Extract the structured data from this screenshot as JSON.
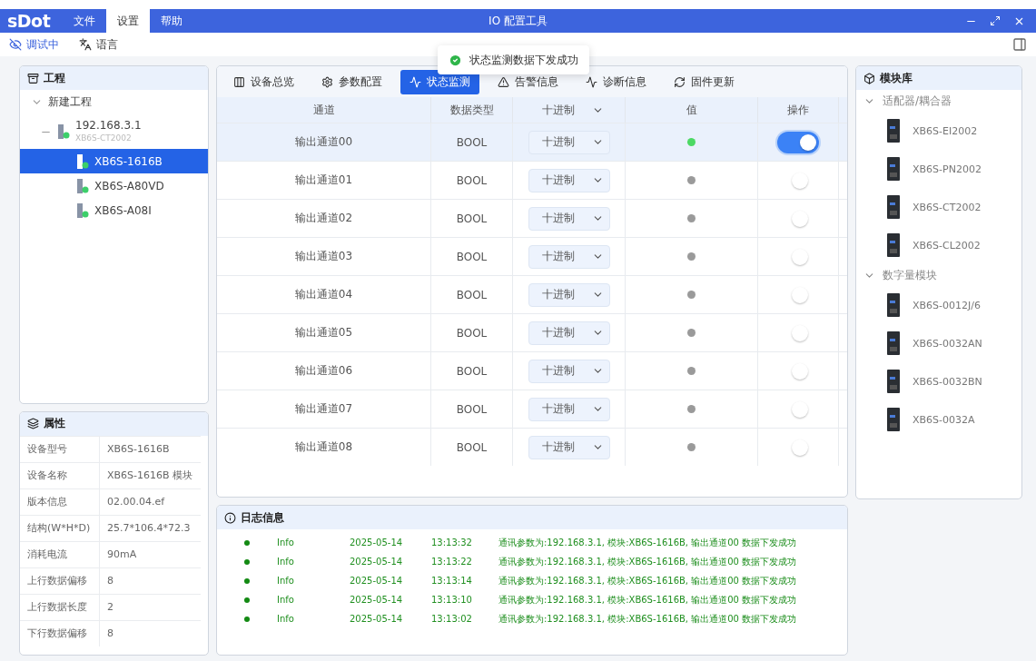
{
  "titlebar": {
    "logo": "sDot",
    "menus": [
      {
        "label": "文件",
        "selected": false
      },
      {
        "label": "设置",
        "selected": true
      },
      {
        "label": "帮助",
        "selected": false
      }
    ],
    "title": "IO 配置工具"
  },
  "toolbar": [
    {
      "kind": "debug",
      "label": "调试中"
    },
    {
      "kind": "language",
      "label": "语言"
    }
  ],
  "toast": {
    "message": "状态监测数据下发成功"
  },
  "project": {
    "title": "工程",
    "tree": [
      {
        "label": "新建工程",
        "expanded": true,
        "selected": false,
        "children": [
          {
            "label": "192.168.3.1",
            "sublabel": "XB6S-CT2002",
            "selected": false,
            "children": [
              {
                "label": "XB6S-1616B",
                "selected": true
              },
              {
                "label": "XB6S-A80VD",
                "selected": false
              },
              {
                "label": "XB6S-A08I",
                "selected": false
              }
            ]
          }
        ]
      }
    ]
  },
  "properties": {
    "title": "属性",
    "rows": [
      {
        "key": "设备型号",
        "value": "XB6S-1616B"
      },
      {
        "key": "设备名称",
        "value": "XB6S-1616B 模块"
      },
      {
        "key": "版本信息",
        "value": "02.00.04.ef"
      },
      {
        "key": "结构(W*H*D)",
        "value": "25.7*106.4*72.3"
      },
      {
        "key": "消耗电流",
        "value": "90mA"
      },
      {
        "key": "上行数据偏移",
        "value": "8"
      },
      {
        "key": "上行数据长度",
        "value": "2"
      },
      {
        "key": "下行数据偏移",
        "value": "8"
      }
    ]
  },
  "tabs": [
    {
      "label": "设备总览",
      "selected": false
    },
    {
      "label": "参数配置",
      "selected": false
    },
    {
      "label": "状态监测",
      "selected": true
    },
    {
      "label": "告警信息",
      "selected": false
    },
    {
      "label": "诊断信息",
      "selected": false
    },
    {
      "label": "固件更新",
      "selected": false
    }
  ],
  "table": {
    "columns": [
      {
        "kind": "text",
        "label": "通道"
      },
      {
        "kind": "text",
        "label": "数据类型"
      },
      {
        "kind": "select",
        "label": "十进制"
      },
      {
        "kind": "text",
        "label": "值"
      },
      {
        "kind": "text",
        "label": "操作"
      }
    ],
    "rows": [
      {
        "channel": "输出通道00",
        "type": "BOOL",
        "format": "十进制",
        "value_on": true,
        "switch_on": true,
        "selected": true
      },
      {
        "channel": "输出通道01",
        "type": "BOOL",
        "format": "十进制",
        "value_on": false,
        "switch_on": false,
        "selected": false
      },
      {
        "channel": "输出通道02",
        "type": "BOOL",
        "format": "十进制",
        "value_on": false,
        "switch_on": false,
        "selected": false
      },
      {
        "channel": "输出通道03",
        "type": "BOOL",
        "format": "十进制",
        "value_on": false,
        "switch_on": false,
        "selected": false
      },
      {
        "channel": "输出通道04",
        "type": "BOOL",
        "format": "十进制",
        "value_on": false,
        "switch_on": false,
        "selected": false
      },
      {
        "channel": "输出通道05",
        "type": "BOOL",
        "format": "十进制",
        "value_on": false,
        "switch_on": false,
        "selected": false
      },
      {
        "channel": "输出通道06",
        "type": "BOOL",
        "format": "十进制",
        "value_on": false,
        "switch_on": false,
        "selected": false
      },
      {
        "channel": "输出通道07",
        "type": "BOOL",
        "format": "十进制",
        "value_on": false,
        "switch_on": false,
        "selected": false
      },
      {
        "channel": "输出通道08",
        "type": "BOOL",
        "format": "十进制",
        "value_on": false,
        "switch_on": false,
        "selected": false
      }
    ]
  },
  "library": {
    "title": "模块库",
    "groups": [
      {
        "label": "适配器/耦合器",
        "expanded": true,
        "items": [
          "XB6S-EI2002",
          "XB6S-PN2002",
          "XB6S-CT2002",
          "XB6S-CL2002"
        ]
      },
      {
        "label": "数字量模块",
        "expanded": true,
        "items": [
          "XB6S-0012J/6",
          "XB6S-0032AN",
          "XB6S-0032BN",
          "XB6S-0032A"
        ]
      }
    ]
  },
  "log": {
    "title": "日志信息",
    "entries": [
      {
        "level": "Info",
        "date": "2025-05-14",
        "time": "13:13:32",
        "message": "通讯参数为:192.168.3.1, 模块:XB6S-1616B, 输出通道00 数据下发成功"
      },
      {
        "level": "Info",
        "date": "2025-05-14",
        "time": "13:13:22",
        "message": "通讯参数为:192.168.3.1, 模块:XB6S-1616B, 输出通道00 数据下发成功"
      },
      {
        "level": "Info",
        "date": "2025-05-14",
        "time": "13:13:14",
        "message": "通讯参数为:192.168.3.1, 模块:XB6S-1616B, 输出通道00 数据下发成功"
      },
      {
        "level": "Info",
        "date": "2025-05-14",
        "time": "13:13:10",
        "message": "通讯参数为:192.168.3.1, 模块:XB6S-1616B, 输出通道00 数据下发成功"
      },
      {
        "level": "Info",
        "date": "2025-05-14",
        "time": "13:13:02",
        "message": "通讯参数为:192.168.3.1, 模块:XB6S-1616B, 输出通道00 数据下发成功"
      }
    ]
  }
}
